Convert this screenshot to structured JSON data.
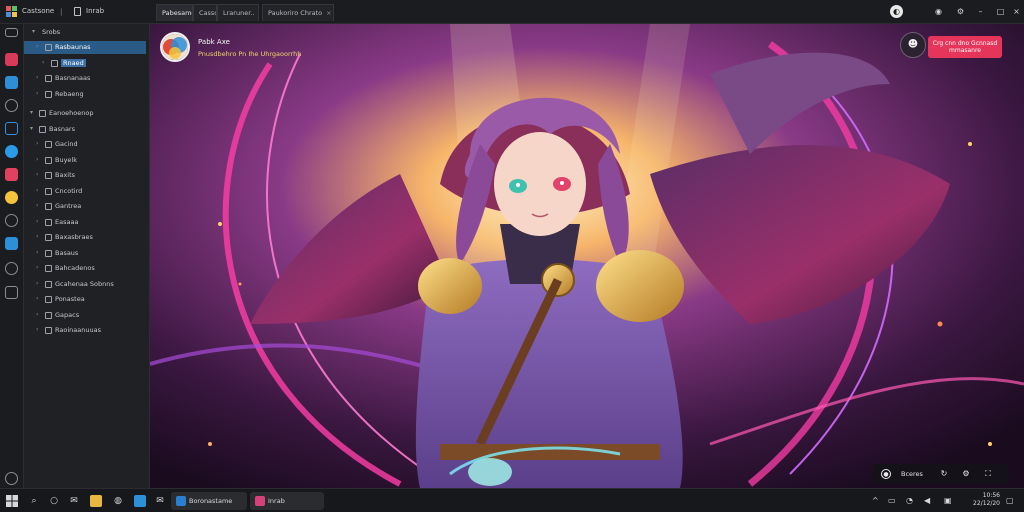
{
  "window": {
    "app_name": "Castsone",
    "separator": "|",
    "title": "Inrab"
  },
  "tabs": [
    {
      "label": "Pabesame",
      "active": true
    },
    {
      "label": "Casso",
      "active": false
    },
    {
      "label": "Lraruner..",
      "active": false,
      "has_close": true
    },
    {
      "label": "Paukoriro Chrato",
      "active": false,
      "has_close": true
    }
  ],
  "titlebar_buttons": [
    "account-icon",
    "chat-icon",
    "settings-icon",
    "minimize-icon",
    "close-icon"
  ],
  "rail": {
    "icons": [
      {
        "name": "document-icon",
        "color": "#8b8e93"
      },
      {
        "name": "brand-red-icon",
        "color": "#d83a5a"
      },
      {
        "name": "folder-blue-icon",
        "color": "#2f8fd6"
      },
      {
        "name": "compass-icon",
        "color": "#8b8e93"
      },
      {
        "name": "building-icon",
        "color": "#3a8de0"
      },
      {
        "name": "globe-icon",
        "color": "#2b9be8"
      },
      {
        "name": "chart-icon",
        "color": "#e0425e"
      },
      {
        "name": "emoji-icon",
        "color": "#f4c33c"
      },
      {
        "name": "chat-bubble-icon",
        "color": "#8b8e93"
      },
      {
        "name": "inbox-icon",
        "color": "#2c8fd8"
      },
      {
        "name": "clock-icon",
        "color": "#8b8e93"
      },
      {
        "name": "users-icon",
        "color": "#8b8e93"
      }
    ],
    "bottom_icon": "power-icon"
  },
  "sidebar": {
    "root_label": "Srobs",
    "items": [
      {
        "label": "Rasbaunas",
        "level": 1,
        "selected": true
      },
      {
        "label": "Rnaed",
        "level": 2,
        "highlight": true
      },
      {
        "label": "Basnanaas",
        "level": 1
      },
      {
        "label": "Rebaeng",
        "level": 1
      },
      {
        "label": "Eanoehoenop",
        "level": 0
      },
      {
        "label": "Basnars",
        "level": 0
      },
      {
        "label": "Gacind",
        "level": 1
      },
      {
        "label": "Buyelk",
        "level": 1
      },
      {
        "label": "Baxits",
        "level": 1
      },
      {
        "label": "Cncotird",
        "level": 1
      },
      {
        "label": "Gantrea",
        "level": 1
      },
      {
        "label": "Easaaa",
        "level": 1
      },
      {
        "label": "Baxasbraes",
        "level": 1
      },
      {
        "label": "Basaus",
        "level": 1
      },
      {
        "label": "Bahcadenos",
        "level": 1
      },
      {
        "label": "Gcahenaa Sobnns",
        "level": 1
      },
      {
        "label": "Ponastea",
        "level": 1
      },
      {
        "label": "Gapacs",
        "level": 1
      },
      {
        "label": "Raoinaanuuas",
        "level": 1
      }
    ]
  },
  "video": {
    "channel_name": "Pabk Axe",
    "channel_subtitle": "Pnusdbehro Pn Ihe Uhrgaoorrhh",
    "mask_icon": "theater-mask-icon",
    "subscribe_label": "Crg cnn dno Gcnnasd mmasanre",
    "controls_label": "Bceres",
    "palette": {
      "accent_pink": "#ff3ea8",
      "accent_purple": "#a64bd8",
      "accent_gold": "#f2c14e",
      "hair": "#9a5aa8",
      "cloak": "#7a2c5a",
      "armor_gold": "#c99a3a"
    }
  },
  "taskbar": {
    "apps": [
      {
        "label": "Boronastame",
        "color": "#2b7fd3"
      },
      {
        "label": "Inrab",
        "color": "#d6417a"
      }
    ],
    "time": "10:56",
    "date": "22/12/20"
  }
}
